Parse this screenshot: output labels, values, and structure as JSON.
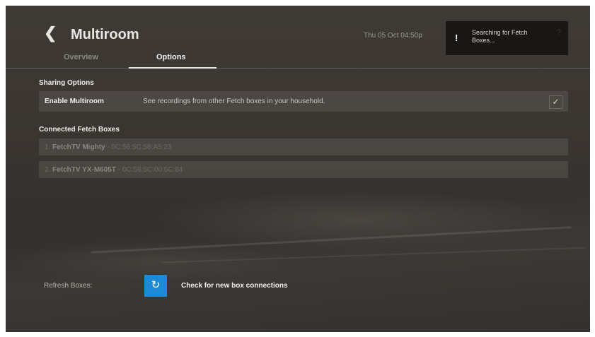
{
  "header": {
    "title": "Multiroom",
    "tabs": [
      {
        "label": "Overview",
        "active": false
      },
      {
        "label": "Options",
        "active": true
      }
    ],
    "clock": "Thu 05 Oct 04:50p"
  },
  "toast": {
    "icon": "alert-icon",
    "message": "Searching for Fetch Boxes...",
    "help_icon": "help-icon"
  },
  "sharing": {
    "heading": "Sharing Options",
    "multiroom_label": "Enable Multiroom",
    "multiroom_description": "See recordings from other Fetch boxes in your household.",
    "multiroom_enabled": true
  },
  "connected": {
    "heading": "Connected Fetch Boxes",
    "boxes": [
      {
        "index": "1.",
        "name": "FetchTV Mighty",
        "mac": "- 0C:56:5C:58:A5:23"
      },
      {
        "index": "2.",
        "name": "FetchTV YX-M605T",
        "mac": "- 0C:56:5C:00:5C:84"
      }
    ]
  },
  "refresh": {
    "label": "Refresh Boxes:",
    "action_text": "Check for new box connections",
    "icon": "refresh-icon"
  },
  "colors": {
    "accent": "#1c8ad6",
    "background": "#3a3531",
    "toast_bg": "#191716"
  }
}
